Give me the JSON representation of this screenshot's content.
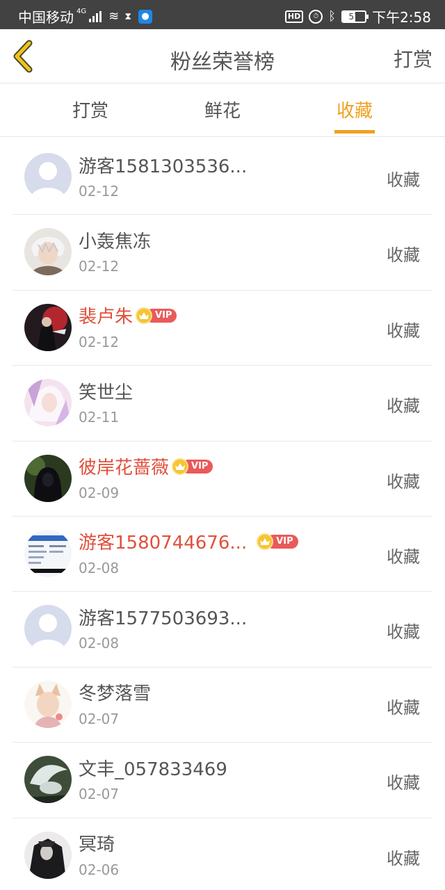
{
  "status_bar": {
    "carrier": "中国移动",
    "network": "4G",
    "hd": "HD",
    "battery": "57",
    "time": "下午2:58"
  },
  "header": {
    "title": "粉丝荣誉榜",
    "action": "打赏"
  },
  "tabs": [
    {
      "label": "打赏",
      "active": false
    },
    {
      "label": "鲜花",
      "active": false
    },
    {
      "label": "收藏",
      "active": true
    }
  ],
  "vip_label": "VIP",
  "colors": {
    "accent": "#f0a020",
    "vip_name": "#e0503c",
    "vip_tag": "#e95a5a"
  },
  "fans": [
    {
      "name": "游客1581303536...",
      "date": "02-12",
      "action": "收藏",
      "vip": false,
      "avatar": "default"
    },
    {
      "name": "小轰焦冻",
      "date": "02-12",
      "action": "收藏",
      "vip": false,
      "avatar": "anime-white-hair"
    },
    {
      "name": "裴卢朱",
      "date": "02-12",
      "action": "收藏",
      "vip": true,
      "avatar": "dark-red"
    },
    {
      "name": "笑世尘",
      "date": "02-11",
      "action": "收藏",
      "vip": false,
      "avatar": "pink-anime"
    },
    {
      "name": "彼岸花蔷薇",
      "date": "02-09",
      "action": "收藏",
      "vip": true,
      "avatar": "dark-hood"
    },
    {
      "name": "游客1580744676...",
      "date": "02-08",
      "action": "收藏",
      "vip": true,
      "avatar": "screenshot"
    },
    {
      "name": "游客1577503693...",
      "date": "02-08",
      "action": "收藏",
      "vip": false,
      "avatar": "default"
    },
    {
      "name": "冬梦落雪",
      "date": "02-07",
      "action": "收藏",
      "vip": false,
      "avatar": "anime-fox"
    },
    {
      "name": "文丰_057833469",
      "date": "02-07",
      "action": "收藏",
      "vip": false,
      "avatar": "winged-horse"
    },
    {
      "name": "冥琦",
      "date": "02-06",
      "action": "收藏",
      "vip": false,
      "avatar": "dark-figure"
    }
  ]
}
